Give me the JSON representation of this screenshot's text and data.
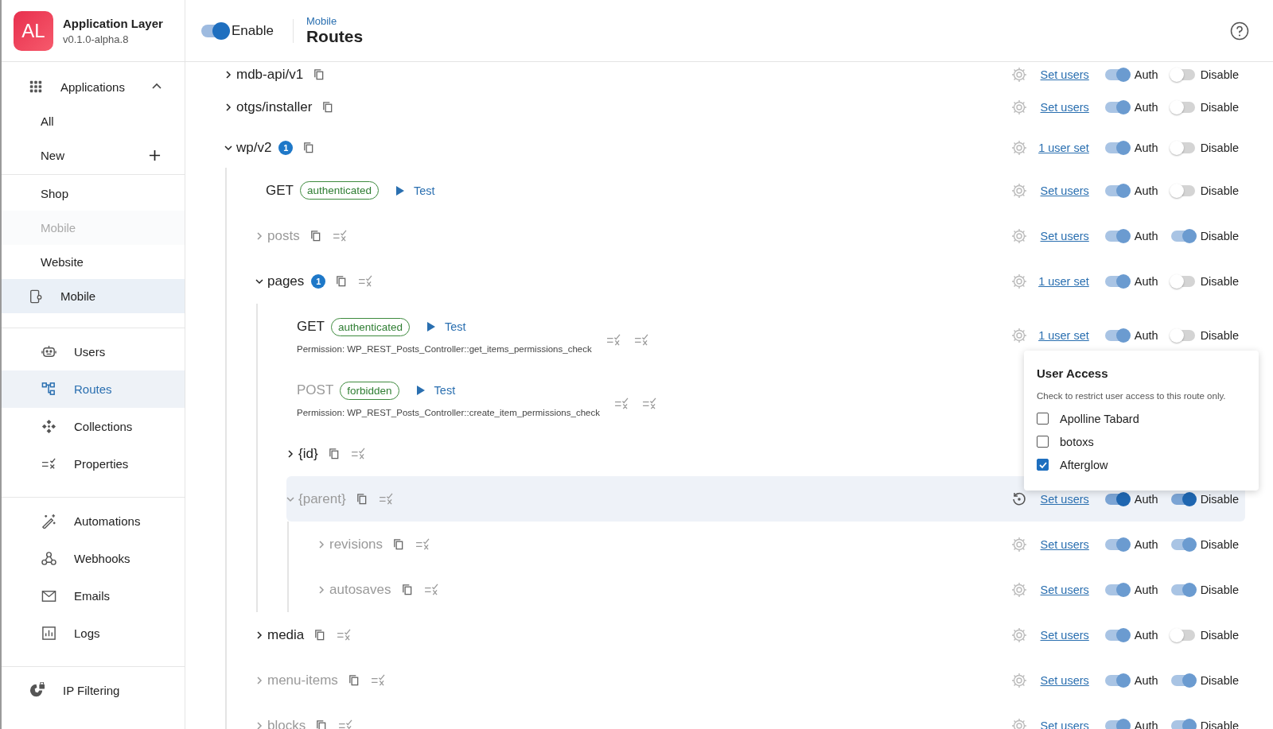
{
  "sidebar": {
    "logo": "AL",
    "app_name": "Application Layer",
    "version": "v0.1.0-alpha.8",
    "applications": {
      "label": "Applications",
      "expanded": true,
      "actions": [
        {
          "label": "All",
          "kind": "plain"
        },
        {
          "label": "New",
          "kind": "add"
        }
      ],
      "apps": [
        {
          "label": "Shop",
          "kind": "plain",
          "selected": false,
          "disabled": false
        },
        {
          "label": "Mobile",
          "kind": "plain",
          "selected": false,
          "disabled": true
        },
        {
          "label": "Website",
          "kind": "plain",
          "selected": false,
          "disabled": false
        },
        {
          "label": "Mobile",
          "kind": "device",
          "selected": true,
          "disabled": false
        }
      ]
    },
    "nav_groups": [
      [
        {
          "label": "Users",
          "selected": false
        },
        {
          "label": "Routes",
          "selected": true
        },
        {
          "label": "Collections",
          "selected": false
        },
        {
          "label": "Properties",
          "selected": false
        }
      ],
      [
        {
          "label": "Automations",
          "selected": false
        },
        {
          "label": "Webhooks",
          "selected": false
        },
        {
          "label": "Emails",
          "selected": false
        },
        {
          "label": "Logs",
          "selected": false
        }
      ],
      [
        {
          "label": "IP Filtering",
          "selected": false
        }
      ]
    ]
  },
  "header": {
    "enable": {
      "label": "Enable",
      "on": true
    },
    "breadcrumb": "Mobile",
    "title": "Routes"
  },
  "routes": [
    {
      "kind": "route",
      "name": "mdb-api/v1",
      "expanded": false,
      "selected": false,
      "users_link": "Set users",
      "auth": true,
      "auth_label": "Auth",
      "disable": false,
      "disable_label": "Disable"
    },
    {
      "kind": "route",
      "name": "otgs/installer",
      "expanded": false,
      "selected": false,
      "users_link": "Set users",
      "auth": true,
      "auth_label": "Auth",
      "disable": false,
      "disable_label": "Disable"
    },
    {
      "kind": "route",
      "name": "wp/v2",
      "expanded": true,
      "selected": false,
      "badge": "1",
      "users_link": "1 user set",
      "auth": true,
      "auth_label": "Auth",
      "disable": false,
      "disable_label": "Disable",
      "children": [
        {
          "kind": "endpoint",
          "method": "GET",
          "status": "authenticated",
          "test": "Test",
          "selected": false,
          "users_link": "Set users",
          "auth": true,
          "auth_label": "Auth",
          "disable": false,
          "disable_label": "Disable"
        },
        {
          "kind": "route",
          "name": "posts",
          "expanded": false,
          "selected": false,
          "users_link": "Set users",
          "auth": true,
          "auth_label": "Auth",
          "disable": true,
          "disable_label": "Disable"
        },
        {
          "kind": "route",
          "name": "pages",
          "expanded": true,
          "selected": false,
          "badge": "1",
          "users_link": "1 user set",
          "auth": true,
          "auth_label": "Auth",
          "disable": false,
          "disable_label": "Disable",
          "children": [
            {
              "kind": "endpoint",
              "method": "GET",
              "status": "authenticated",
              "test": "Test",
              "permission": "Permission: WP_REST_Posts_Controller::get_items_permissions_check",
              "selected": false,
              "users_link": "1 user set",
              "auth": true,
              "auth_label": "Auth",
              "disable": false,
              "disable_label": "Disable"
            },
            {
              "kind": "endpoint",
              "method": "POST",
              "status": "forbidden",
              "test": "Test",
              "permission": "Permission: WP_REST_Posts_Controller::create_item_permissions_check",
              "selected": false,
              "disable": true
            },
            {
              "kind": "route",
              "name": "{id}",
              "expanded": false,
              "selected": false,
              "disable": false
            },
            {
              "kind": "route",
              "name": "{parent}",
              "expanded": true,
              "selected": true,
              "users_link": "Set users",
              "auth": true,
              "auth_label": "Auth",
              "disable": true,
              "disable_label": "Disable",
              "children": [
                {
                  "kind": "route",
                  "name": "revisions",
                  "expanded": false,
                  "selected": false,
                  "users_link": "Set users",
                  "auth": true,
                  "auth_label": "Auth",
                  "disable": true,
                  "disable_label": "Disable"
                },
                {
                  "kind": "route",
                  "name": "autosaves",
                  "expanded": false,
                  "selected": false,
                  "users_link": "Set users",
                  "auth": true,
                  "auth_label": "Auth",
                  "disable": true,
                  "disable_label": "Disable"
                }
              ]
            }
          ]
        },
        {
          "kind": "route",
          "name": "media",
          "expanded": false,
          "selected": false,
          "users_link": "Set users",
          "auth": true,
          "auth_label": "Auth",
          "disable": false,
          "disable_label": "Disable"
        },
        {
          "kind": "route",
          "name": "menu-items",
          "expanded": false,
          "selected": false,
          "users_link": "Set users",
          "auth": true,
          "auth_label": "Auth",
          "disable": true,
          "disable_label": "Disable"
        },
        {
          "kind": "route",
          "name": "blocks",
          "expanded": false,
          "selected": false,
          "users_link": "Set users",
          "auth": true,
          "auth_label": "Auth",
          "disable": true,
          "disable_label": "Disable"
        }
      ]
    }
  ],
  "user_access": {
    "title": "User Access",
    "hint": "Check to restrict user access to this route only.",
    "users": [
      {
        "name": "Apolline Tabard",
        "checked": false
      },
      {
        "name": "botoxs",
        "checked": false
      },
      {
        "name": "Afterglow",
        "checked": true
      }
    ]
  }
}
